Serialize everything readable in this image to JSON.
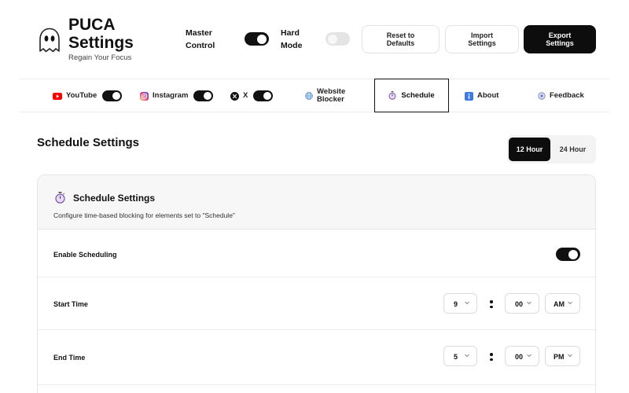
{
  "app": {
    "title": "PUCA Settings",
    "title_line1": "PUCA",
    "title_line2": "Settings",
    "subtitle": "Regain Your Focus"
  },
  "header": {
    "master_control": {
      "line1": "Master",
      "line2": "Control",
      "on": true
    },
    "hard_mode": {
      "line1": "Hard",
      "line2": "Mode",
      "on": false
    },
    "buttons": {
      "reset": {
        "line1": "Reset to",
        "line2": "Defaults"
      },
      "import": {
        "line1": "Import",
        "line2": "Settings"
      },
      "export": {
        "line1": "Export",
        "line2": "Settings"
      }
    }
  },
  "tabs": {
    "youtube": {
      "label": "YouTube",
      "icon": "youtube-icon",
      "on": true
    },
    "instagram": {
      "label": "Instagram",
      "icon": "instagram-icon",
      "on": true
    },
    "x": {
      "label": "X",
      "icon": "x-logo-icon",
      "on": true
    },
    "website_blocker": {
      "line1": "Website",
      "line2": "Blocker",
      "icon": "globe-icon"
    },
    "schedule": {
      "label": "Schedule",
      "icon": "stopwatch-icon",
      "active": true
    },
    "about": {
      "label": "About",
      "icon": "info-icon"
    },
    "feedback": {
      "label": "Feedback",
      "icon": "feedback-icon"
    }
  },
  "schedule_page": {
    "heading": "Schedule Settings",
    "time_format": {
      "option_12": "12 Hour",
      "option_24": "24 Hour",
      "selected": "12 Hour"
    },
    "card": {
      "title": "Schedule Settings",
      "description": "Configure time-based blocking for elements set to \"Schedule\"",
      "enable": {
        "label": "Enable Scheduling",
        "on": true
      },
      "start_time": {
        "label": "Start Time",
        "hour": "9",
        "minute": "00",
        "period": "AM"
      },
      "end_time": {
        "label": "End Time",
        "hour": "5",
        "minute": "00",
        "period": "PM"
      }
    }
  },
  "colors": {
    "accent": "#0d0d0d",
    "toggle_off": "#e4e4e4",
    "youtube_red": "#ff0000",
    "instagram_gradient": [
      "#feda75",
      "#d62976",
      "#4f5bd5"
    ],
    "info_blue": "#3d7be0"
  }
}
